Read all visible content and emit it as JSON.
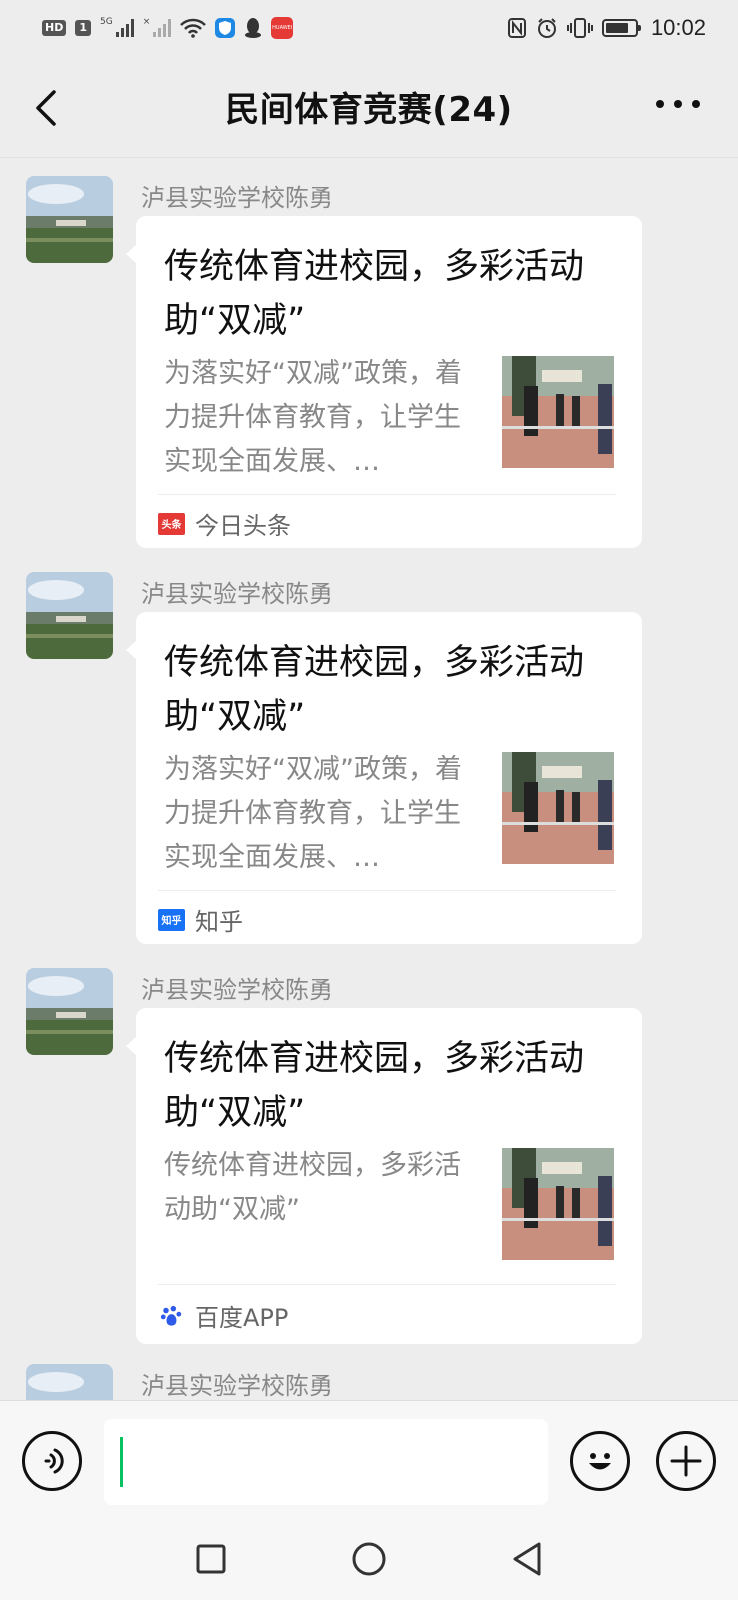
{
  "status_bar": {
    "hd_label": "HD",
    "sim1": "1",
    "net_5g": "5G",
    "net_x": "×",
    "huawei_app_label": "HUAWEI",
    "time": "10:02"
  },
  "nav": {
    "title": "民间体育竞赛(24)"
  },
  "messages": [
    {
      "sender": "泸县实验学校陈勇",
      "title": "传统体育进校园，多彩活动助“双减”",
      "desc": "为落实好“双减”政策，着力提升体育教育，让学生实现全面发展、…",
      "source": "今日头条",
      "source_icon": "toutiao-icon",
      "source_icon_text": "头条",
      "source_color": "#e53935"
    },
    {
      "sender": "泸县实验学校陈勇",
      "title": "传统体育进校园，多彩活动助“双减”",
      "desc": "为落实好“双减”政策，着力提升体育教育，让学生实现全面发展、…",
      "source": "知乎",
      "source_icon": "zhihu-icon",
      "source_icon_text": "知乎",
      "source_color": "#1772f6"
    },
    {
      "sender": "泸县实验学校陈勇",
      "title": "传统体育进校园，多彩活动助“双减”",
      "desc": "传统体育进校园，多彩活动助“双减”",
      "source": "百度APP",
      "source_icon": "baidu-paw-icon",
      "source_icon_text": "du",
      "source_color": "#2f5bea"
    },
    {
      "sender": "泸县实验学校陈勇"
    }
  ],
  "input": {
    "value": "",
    "placeholder": ""
  },
  "colors": {
    "background": "#ededed",
    "card": "#ffffff",
    "caret": "#07c160",
    "sender_text": "#888888"
  }
}
